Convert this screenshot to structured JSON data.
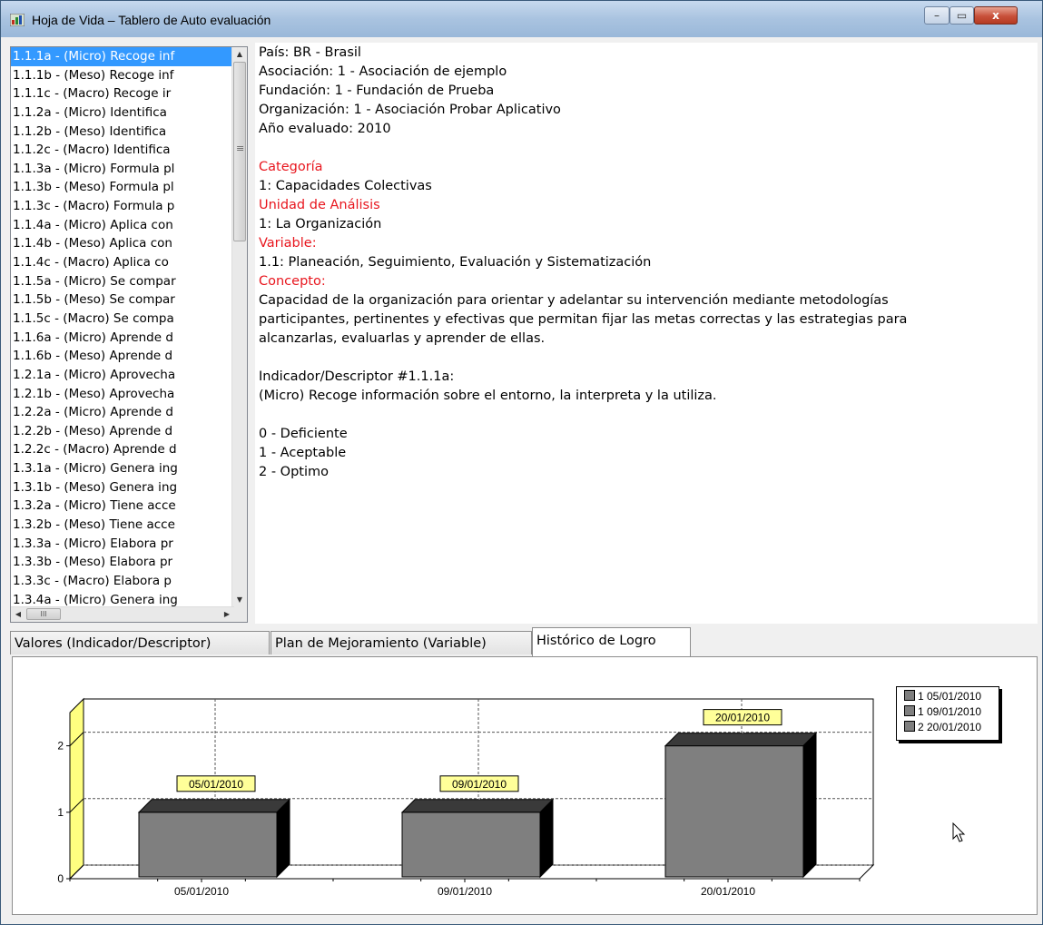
{
  "window": {
    "title": "Hoja de Vida – Tablero de Auto evaluación",
    "minimize": "–",
    "maximize": "▭",
    "close": "x"
  },
  "indicator_list": {
    "selected_index": 0,
    "items": [
      "1.1.1a - (Micro) Recoge inf",
      "1.1.1b - (Meso) Recoge inf",
      "1.1.1c - (Macro) Recoge ir",
      "1.1.2a - (Micro) Identifica",
      "1.1.2b - (Meso) Identifica",
      "1.1.2c - (Macro) Identifica",
      "1.1.3a - (Micro) Formula pl",
      "1.1.3b - (Meso) Formula pl",
      "1.1.3c - (Macro) Formula p",
      "1.1.4a - (Micro) Aplica con",
      "1.1.4b - (Meso) Aplica con",
      "1.1.4c - (Macro) Aplica co",
      "1.1.5a - (Micro) Se compar",
      "1.1.5b - (Meso) Se compar",
      "1.1.5c - (Macro) Se compa",
      "1.1.6a - (Micro) Aprende d",
      "1.1.6b - (Meso) Aprende d",
      "1.2.1a - (Micro) Aprovecha",
      "1.2.1b - (Meso) Aprovecha",
      "1.2.2a - (Micro) Aprende d",
      "1.2.2b - (Meso) Aprende d",
      "1.2.2c - (Macro) Aprende d",
      "1.3.1a - (Micro) Genera ing",
      "1.3.1b - (Meso) Genera ing",
      "1.3.2a - (Micro) Tiene acce",
      "1.3.2b - (Meso) Tiene acce",
      "1.3.3a - (Micro) Elabora pr",
      "1.3.3b - (Meso) Elabora pr",
      "1.3.3c - (Macro) Elabora p",
      "1.3.4a - (Micro) Genera ing"
    ],
    "scroll_up": "▲",
    "scroll_down": "▼",
    "scroll_left": "◀",
    "scroll_right": "▶",
    "h_thumb_grip": "III",
    "v_thumb_grip": "≡"
  },
  "detail": {
    "pais": "País: BR - Brasil",
    "asociacion": "Asociación: 1 - Asociación de ejemplo",
    "fundacion": "Fundación: 1 - Fundación de Prueba",
    "organizacion": "Organización: 1 - Asociación Probar Aplicativo",
    "anio": "Año evaluado: 2010",
    "categoria_label": "Categoría",
    "categoria_value": "1: Capacidades Colectivas",
    "unidad_label": "Unidad de Análisis",
    "unidad_value": "1: La Organización",
    "variable_label": "Variable:",
    "variable_value": "1.1: Planeación, Seguimiento, Evaluación y Sistematización",
    "concepto_label": "Concepto:",
    "concepto_line1": "Capacidad de la organización para orientar y adelantar su intervención mediante metodologías",
    "concepto_line2": "participantes, pertinentes y efectivas que permitan fijar las metas correctas y las estrategias para",
    "concepto_line3": "alcanzarlas, evaluarlas y aprender de ellas.",
    "indicador_label": "Indicador/Descriptor #1.1.1a:",
    "indicador_value": "(Micro) Recoge información sobre el entorno, la interpreta y la utiliza.",
    "escala": [
      "0 - Deficiente",
      "1 - Aceptable",
      "2 - Optimo"
    ]
  },
  "tabs": [
    "Valores (Indicador/Descriptor)",
    "Plan de Mejoramiento (Variable)",
    "Histórico de Logro"
  ],
  "active_tab": 2,
  "colors": {
    "selection": "#3399ff",
    "red_label": "#e8161e",
    "bar": "#7f7f7f",
    "bar_dark": "#3a3a3a",
    "wall": "#ffff80",
    "data_label_bg": "#ffff99"
  },
  "chart_data": {
    "type": "bar",
    "three_d": true,
    "categories": [
      "05/01/2010",
      "09/01/2010",
      "20/01/2010"
    ],
    "values": [
      1,
      1,
      2
    ],
    "point_labels": [
      "05/01/2010",
      "09/01/2010",
      "20/01/2010"
    ],
    "legend": [
      "1 05/01/2010",
      "1 09/01/2010",
      "2 20/01/2010"
    ],
    "legend_position": "top-right",
    "ylim": [
      0,
      2.5
    ],
    "yticks": [
      0,
      1,
      2
    ],
    "grid": true,
    "title": "",
    "xlabel": "",
    "ylabel": ""
  }
}
